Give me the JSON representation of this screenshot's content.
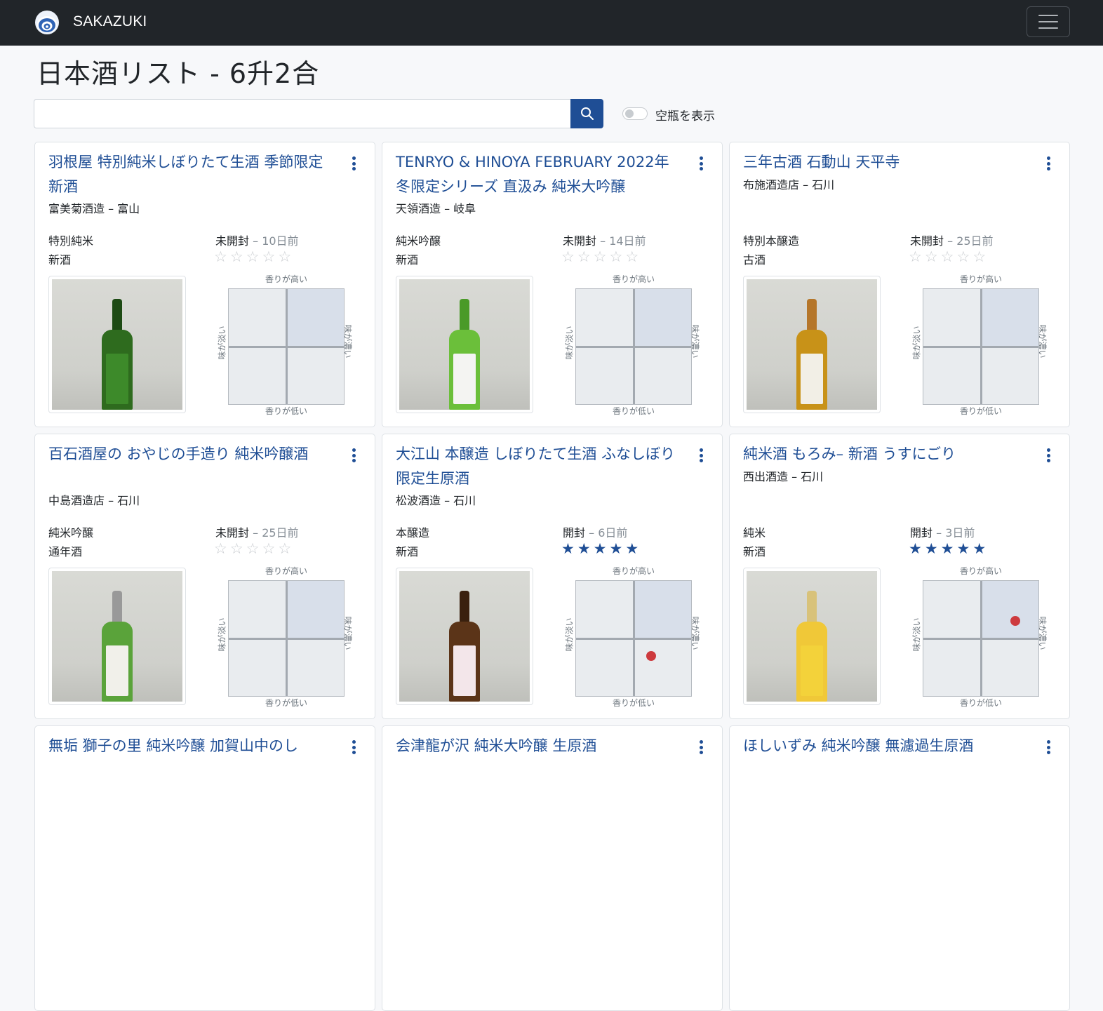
{
  "navbar": {
    "brand": "SAKAZUKI",
    "menu_icon": "hamburger-icon"
  },
  "page": {
    "title": "日本酒リスト - 6升2合"
  },
  "search": {
    "placeholder": "",
    "button_icon": "search-icon"
  },
  "toggle": {
    "label": "空瓶を表示",
    "checked": false
  },
  "chart_axes": {
    "top": "香りが高い",
    "bottom": "香りが低い",
    "left": "味が淡い",
    "right": "味が濃い"
  },
  "colors": {
    "navbar": "#212529",
    "accent": "#1f4e95",
    "dot": "#cd3a3e"
  },
  "cards": [
    {
      "title": "羽根屋 特別純米しぼりたて生酒 季節限定 新酒",
      "brewery": "富美菊酒造 – 富山",
      "type1": "特別純米",
      "type2": "新酒",
      "status": "未開封",
      "age": "10日前",
      "rating": 0,
      "dot": null
    },
    {
      "title": "TENRYO & HINOYA FEBRUARY 2022年 冬限定シリーズ 直汲み 純米大吟醸",
      "brewery": "天領酒造 – 岐阜",
      "type1": "純米吟醸",
      "type2": "新酒",
      "status": "未開封",
      "age": "14日前",
      "rating": 0,
      "dot": null
    },
    {
      "title": "三年古酒 石動山 天平寺",
      "brewery": "布施酒造店 – 石川",
      "type1": "特別本醸造",
      "type2": "古酒",
      "status": "未開封",
      "age": "25日前",
      "rating": 0,
      "dot": null
    },
    {
      "title": "百石酒屋の おやじの手造り 純米吟醸酒",
      "brewery": "中島酒造店 – 石川",
      "type1": "純米吟醸",
      "type2": "通年酒",
      "status": "未開封",
      "age": "25日前",
      "rating": 0,
      "dot": null
    },
    {
      "title": "大江山 本醸造 しぼりたて生酒 ふなしぼり限定生原酒",
      "brewery": "松波酒造 – 石川",
      "type1": "本醸造",
      "type2": "新酒",
      "status": "開封",
      "age": "6日前",
      "rating": 5,
      "dot": {
        "taste": 0.3,
        "aroma": -0.3
      }
    },
    {
      "title": "純米酒 もろみ– 新酒 うすにごり",
      "brewery": "西出酒造 – 石川",
      "type1": "純米",
      "type2": "新酒",
      "status": "開封",
      "age": "3日前",
      "rating": 5,
      "dot": {
        "taste": 0.6,
        "aroma": 0.3
      }
    },
    {
      "title": "無垢 獅子の里 純米吟醸 加賀山中のし",
      "brewery": "",
      "type1": "",
      "type2": "",
      "status": "",
      "age": "",
      "rating": 0,
      "dot": null
    },
    {
      "title": "会津龍が沢 純米大吟醸 生原酒",
      "brewery": "",
      "type1": "",
      "type2": "",
      "status": "",
      "age": "",
      "rating": 0,
      "dot": null
    },
    {
      "title": "ほしいずみ 純米吟醸 無濾過生原酒",
      "brewery": "",
      "type1": "",
      "type2": "",
      "status": "",
      "age": "",
      "rating": 0,
      "dot": null
    }
  ]
}
